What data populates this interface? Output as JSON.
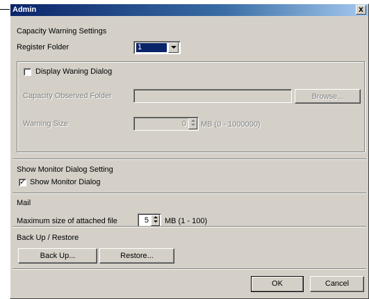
{
  "window": {
    "title": "Admin",
    "close_glyph": "x"
  },
  "capacity": {
    "section_title": "Capacity Warning Settings",
    "register_folder_label": "Register Folder",
    "register_folder_value": "1",
    "display_warning": {
      "label": "Display Waning Dialog",
      "checked": false
    },
    "observed_folder_label": "Capacity Observed Folder",
    "observed_folder_value": "",
    "browse_label": "Browse...",
    "warning_size_label": "Warning Size",
    "warning_size_value": "0",
    "warning_size_unit": "MB (0 - 1000000)"
  },
  "monitor": {
    "section_title": "Show Monitor Dialog Setting",
    "checkbox_label": "Show Monitor Dialog",
    "checked": true,
    "check_glyph": "✓"
  },
  "mail": {
    "section_title": "Mail",
    "max_size_label": "Maximum size of attached file",
    "max_size_value": "5",
    "max_size_unit": "MB (1 - 100)"
  },
  "backup": {
    "section_title": "Back Up / Restore",
    "backup_label": "Back Up...",
    "restore_label": "Restore..."
  },
  "footer": {
    "ok_label": "OK",
    "cancel_label": "Cancel"
  },
  "colors": {
    "title_bar": "#0a246a",
    "face": "#d4d0c8",
    "selection": "#0a246a"
  }
}
